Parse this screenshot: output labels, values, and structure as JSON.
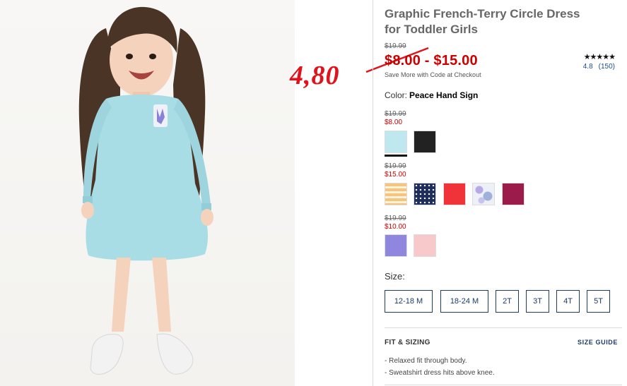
{
  "product": {
    "title": "Graphic French-Terry Circle Dress for Toddler Girls",
    "original_price": "$19.99",
    "sale_price": "$8.00 - $15.00",
    "save_note": "Save More with Code at Checkout",
    "stars": "★★★★★",
    "rating_value": "4.8",
    "review_count": "(150)",
    "color_label": "Color:",
    "color_value": "Peace Hand Sign"
  },
  "annotation": {
    "text": "4,80",
    "color": "#e0121b"
  },
  "price_groups": [
    {
      "old": "$19.99",
      "new": "$8.00",
      "swatches": [
        {
          "name": "aqua-swatch",
          "color": "#bfe7ef",
          "selected": true
        },
        {
          "name": "black-swatch",
          "color": "#222222",
          "selected": false
        }
      ]
    },
    {
      "old": "$19.99",
      "new": "$15.00",
      "swatches": [
        {
          "name": "orange-stripe-swatch",
          "color": "#f6c47a",
          "selected": false
        },
        {
          "name": "navy-dot-swatch",
          "color": "#1f2d5a",
          "selected": false
        },
        {
          "name": "red-swatch",
          "color": "#ef3338",
          "selected": false
        },
        {
          "name": "floral-swatch",
          "color": "#b7a8e6",
          "selected": false
        },
        {
          "name": "berry-swatch",
          "color": "#9b1b4b",
          "selected": false
        }
      ]
    },
    {
      "old": "$19.99",
      "new": "$10.00",
      "swatches": [
        {
          "name": "lavender-swatch",
          "color": "#8f86e0",
          "selected": false
        },
        {
          "name": "pink-swatch",
          "color": "#f8c9cb",
          "selected": false
        }
      ]
    }
  ],
  "sizes": {
    "label": "Size:",
    "options": [
      "12-18 M",
      "18-24 M",
      "2T",
      "3T",
      "4T",
      "5T"
    ]
  },
  "fit": {
    "title": "FIT & SIZING",
    "size_guide": "SIZE GUIDE",
    "items": [
      "Relaxed fit through body.",
      "Sweatshirt dress hits above knee."
    ]
  },
  "colors": {
    "accent_navy": "#1e3a66",
    "sale_red": "#cc0000"
  }
}
